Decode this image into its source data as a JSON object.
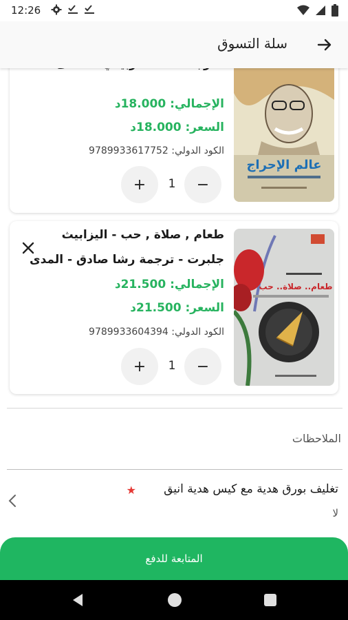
{
  "status_bar": {
    "time": "12:26",
    "left_icons": [
      "gear-icon",
      "check-download-icon",
      "check-download-icon"
    ],
    "right_icons": [
      "wifi-icon",
      "signal-icon",
      "battery-icon"
    ]
  },
  "app_bar": {
    "title": "سلة التسوق",
    "back_icon": "arrow-right-icon"
  },
  "cart_items": [
    {
      "title_line_1": "- ترجمة احمد الزبيدي - المدى",
      "total": "الإجمالي: 18.000د",
      "price": "السعر: 18.000د",
      "isbn": "الكود الدولي: 9789933617752",
      "quantity": "1",
      "cover_text": "عالم الإحراج",
      "plus_label": "+",
      "minus_label": "−"
    },
    {
      "title_line_1": "طعام , صلاة , حب - اليزابيث",
      "title_line_2": "جلبرت - ترجمة رشا صادق - المدى",
      "total": "الإجمالي: 21.500د",
      "price": "السعر: 21.500د",
      "isbn": "الكود الدولي: 9789933604394",
      "quantity": "1",
      "cover_text": "طعام.. صلاة.. حب",
      "plus_label": "+",
      "minus_label": "−"
    }
  ],
  "notes": {
    "label": "الملاحظات"
  },
  "gift_wrap": {
    "title": "تغليف بورق هدية مع كيس هدية انيق",
    "required": "★",
    "value": "لا"
  },
  "checkout": {
    "label": "المتابعة للدفع"
  },
  "colors": {
    "accent_green": "#1fb661",
    "price_green": "#27b35f",
    "required_red": "#e53935"
  }
}
